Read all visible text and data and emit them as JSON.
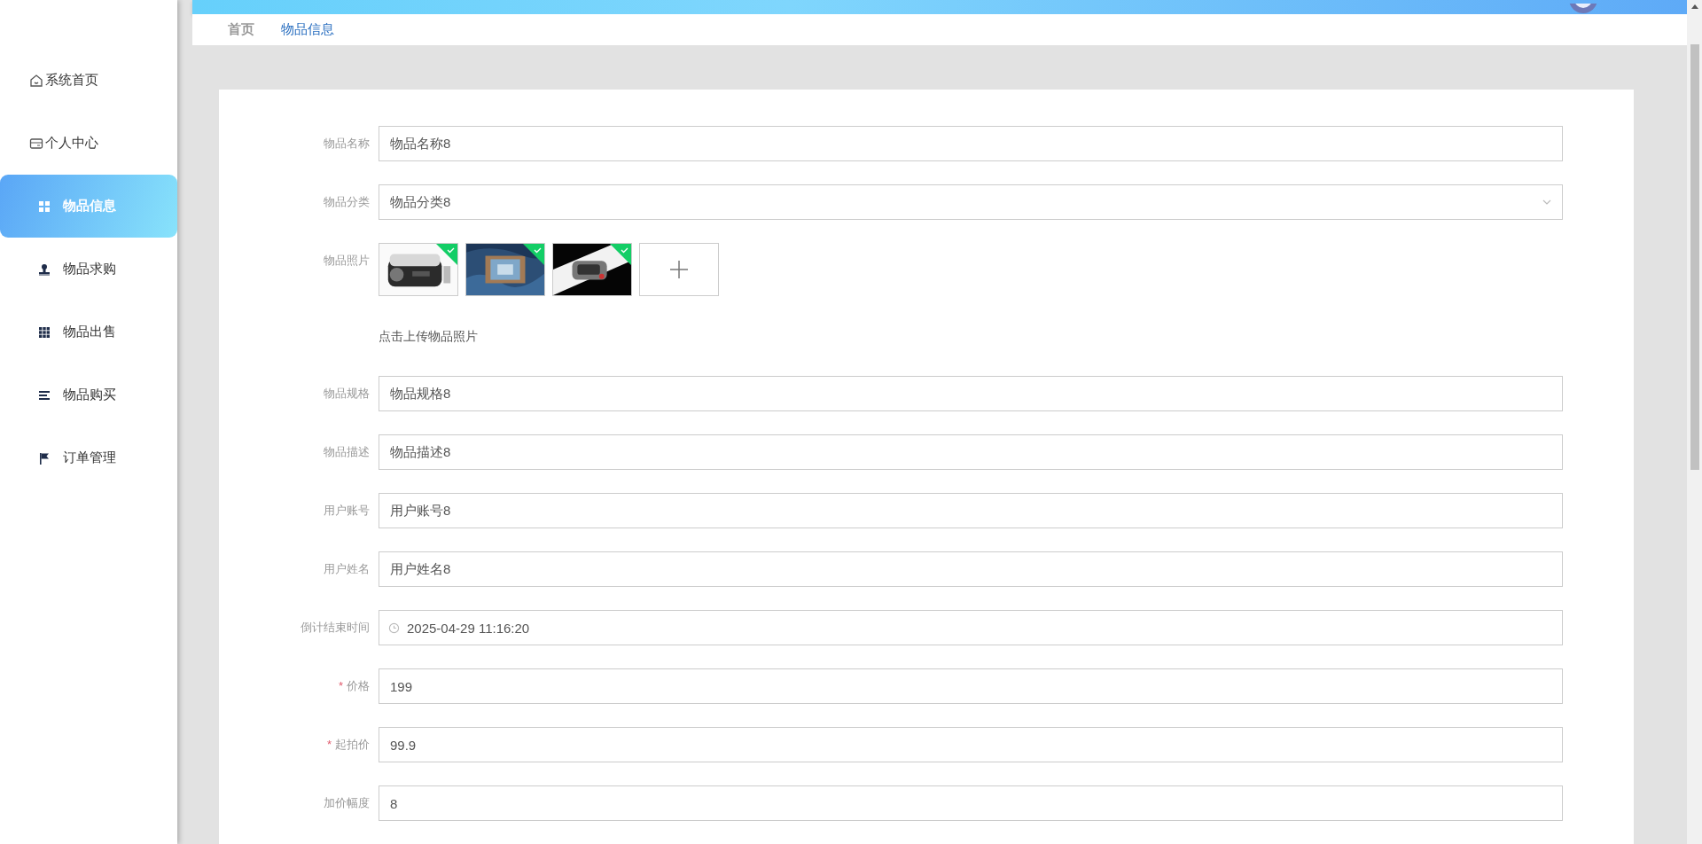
{
  "sidebar": {
    "items": [
      {
        "label": "系统首页",
        "selected": false
      },
      {
        "label": "个人中心",
        "selected": false
      },
      {
        "label": "物品信息",
        "selected": true
      },
      {
        "label": "物品求购",
        "selected": false
      },
      {
        "label": "物品出售",
        "selected": false
      },
      {
        "label": "物品购买",
        "selected": false
      },
      {
        "label": "订单管理",
        "selected": false
      }
    ]
  },
  "breadcrumb": [
    {
      "label": "首页",
      "selected": false
    },
    {
      "label": "物品信息",
      "selected": true
    }
  ],
  "form": {
    "fields": [
      {
        "kind": "text",
        "label": "物品名称",
        "value": "物品名称8"
      },
      {
        "kind": "select",
        "label": "物品分类",
        "value": "物品分类8"
      },
      {
        "kind": "photos",
        "label": "物品照片",
        "photos": [
          {
            "uploaded": true
          },
          {
            "uploaded": true
          },
          {
            "uploaded": true
          }
        ],
        "hint": "点击上传物品照片"
      },
      {
        "kind": "text",
        "label": "物品规格",
        "value": "物品规格8"
      },
      {
        "kind": "text",
        "label": "物品描述",
        "value": "物品描述8"
      },
      {
        "kind": "text",
        "label": "用户账号",
        "value": "用户账号8"
      },
      {
        "kind": "text",
        "label": "用户姓名",
        "value": "用户姓名8"
      },
      {
        "kind": "date",
        "label": "倒计结束时间",
        "value": "2025-04-29 11:16:20"
      },
      {
        "kind": "text",
        "label": "价格",
        "value": "199",
        "required_mark": "*"
      },
      {
        "kind": "text",
        "label": "起拍价",
        "value": "99.9",
        "required_mark": "*"
      },
      {
        "kind": "text",
        "label": "加价幅度",
        "value": "8"
      }
    ]
  }
}
